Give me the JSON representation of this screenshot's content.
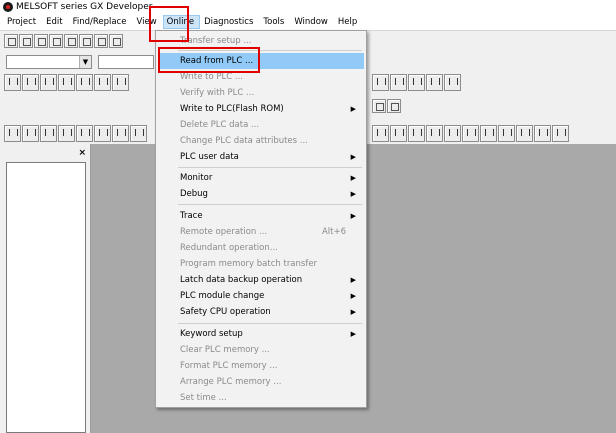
{
  "window": {
    "title": "MELSOFT series GX Developer",
    "icon": "melsoft-app-icon"
  },
  "menubar": {
    "items": [
      {
        "label": "Project"
      },
      {
        "label": "Edit"
      },
      {
        "label": "Find/Replace"
      },
      {
        "label": "View"
      },
      {
        "label": "Online"
      },
      {
        "label": "Diagnostics"
      },
      {
        "label": "Tools"
      },
      {
        "label": "Window"
      },
      {
        "label": "Help"
      }
    ],
    "active": "Online"
  },
  "online_menu": {
    "items": [
      {
        "label": "Transfer setup ...",
        "enabled": false,
        "submenu": false
      },
      {
        "label": "Read from PLC ...",
        "enabled": true,
        "submenu": false,
        "highlighted": true
      },
      {
        "label": "Write to PLC ...",
        "enabled": false,
        "submenu": false
      },
      {
        "label": "Verify with PLC ...",
        "enabled": false,
        "submenu": false
      },
      {
        "label": "Write to PLC(Flash ROM)",
        "enabled": true,
        "submenu": true
      },
      {
        "label": "Delete PLC data ...",
        "enabled": false,
        "submenu": false
      },
      {
        "label": "Change PLC data attributes ...",
        "enabled": false,
        "submenu": false
      },
      {
        "label": "PLC user data",
        "enabled": true,
        "submenu": true
      },
      {
        "label": "Monitor",
        "enabled": true,
        "submenu": true
      },
      {
        "label": "Debug",
        "enabled": true,
        "submenu": true
      },
      {
        "label": "Trace",
        "enabled": true,
        "submenu": true
      },
      {
        "label": "Remote operation ...",
        "enabled": false,
        "submenu": false,
        "shortcut": "Alt+6"
      },
      {
        "label": "Redundant operation...",
        "enabled": false,
        "submenu": false
      },
      {
        "label": "Program memory batch transfer",
        "enabled": false,
        "submenu": false
      },
      {
        "label": "Latch data backup operation",
        "enabled": true,
        "submenu": true
      },
      {
        "label": "PLC module change",
        "enabled": true,
        "submenu": true
      },
      {
        "label": "Safety CPU operation",
        "enabled": true,
        "submenu": true
      },
      {
        "label": "Keyword setup",
        "enabled": true,
        "submenu": true
      },
      {
        "label": "Clear PLC memory ...",
        "enabled": false,
        "submenu": false
      },
      {
        "label": "Format PLC memory ...",
        "enabled": false,
        "submenu": false
      },
      {
        "label": "Arrange PLC memory ...",
        "enabled": false,
        "submenu": false
      },
      {
        "label": "Set time ...",
        "enabled": false,
        "submenu": false
      }
    ],
    "submenu_arrow": "▶"
  },
  "project_panel": {
    "close_label": "×"
  },
  "colors": {
    "menu_hover": "#91c9f7",
    "highlight_box": "#e00000",
    "client_bg": "#a9a9a9",
    "disabled_text": "#8a8a8a"
  }
}
